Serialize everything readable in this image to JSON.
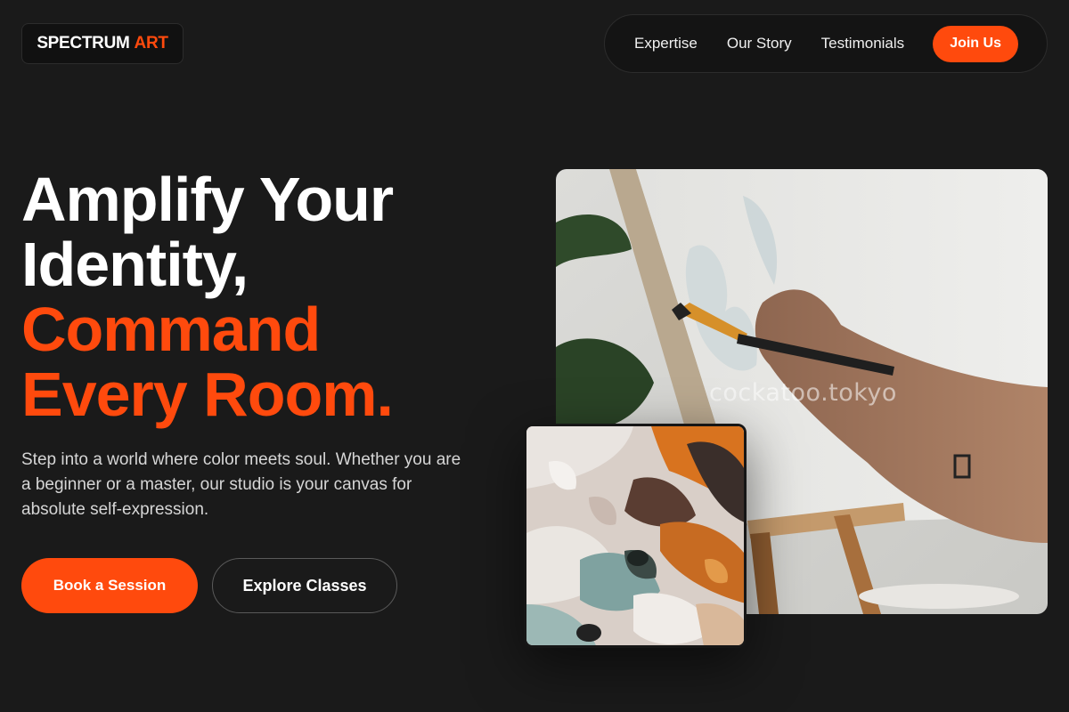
{
  "brand": {
    "name": "SPECTRUM",
    "accent": "ART"
  },
  "nav": {
    "links": [
      "Expertise",
      "Our Story",
      "Testimonials"
    ],
    "cta": "Join Us"
  },
  "hero": {
    "headline_line1": "Amplify Your",
    "headline_line2": "Identity,",
    "headline_line3": "Command",
    "headline_line4": "Every Room.",
    "subtext": "Step into a world where color meets soul. Whether you are a beginner or a master, our studio is your canvas for absolute self-expression.",
    "primary_button": "Book a Session",
    "secondary_button": "Explore Classes",
    "watermark": "cockatoo.tokyo"
  },
  "colors": {
    "background": "#1a1a1a",
    "accent": "#ff4a0d",
    "nav_background": "#141414"
  }
}
